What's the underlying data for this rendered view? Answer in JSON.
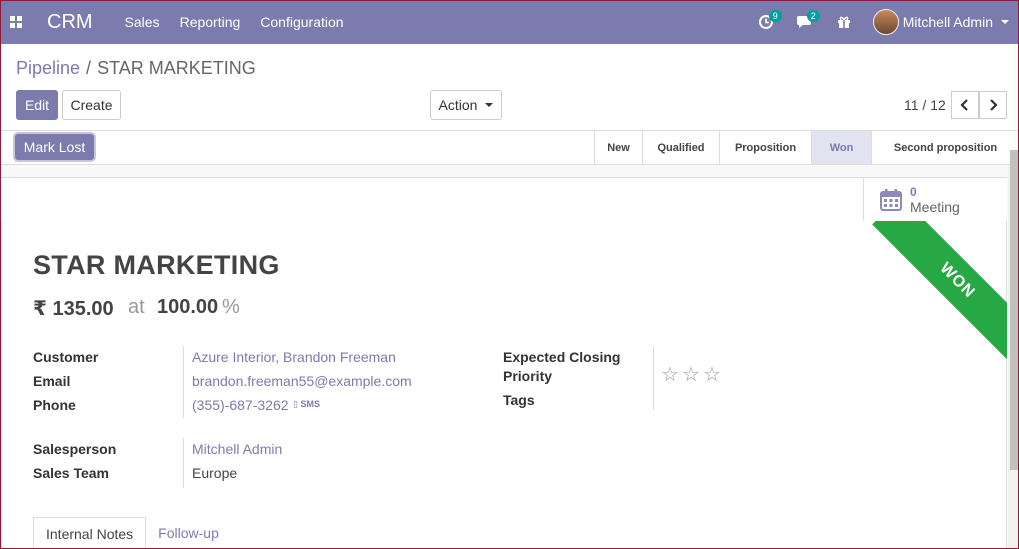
{
  "navbar": {
    "brand": "CRM",
    "menu": [
      "Sales",
      "Reporting",
      "Configuration"
    ],
    "activities_count": "9",
    "messages_count": "2",
    "user_name": "Mitchell Admin"
  },
  "breadcrumb": {
    "parent": "Pipeline",
    "separator": "/",
    "current": "STAR MARKETING"
  },
  "toolbar": {
    "edit_label": "Edit",
    "create_label": "Create",
    "action_label": "Action",
    "pager": "11 / 12"
  },
  "statusbar": {
    "mark_lost_label": "Mark Lost",
    "stages": [
      "New",
      "Qualified",
      "Proposition",
      "Won",
      "Second proposition"
    ],
    "active_stage": "Won"
  },
  "smart_button": {
    "count": "0",
    "label": "Meeting"
  },
  "ribbon": "WON",
  "lead": {
    "name": "STAR MARKETING",
    "revenue": "₹ 135.00",
    "at": "at",
    "probability": "100.00",
    "percent": "%"
  },
  "fields": {
    "customer_label": "Customer",
    "customer_value": "Azure Interior, Brandon Freeman",
    "email_label": "Email",
    "email_value": "brandon.freeman55@example.com",
    "phone_label": "Phone",
    "phone_value": "(355)-687-3262",
    "sms_label": "SMS",
    "salesperson_label": "Salesperson",
    "salesperson_value": "Mitchell Admin",
    "sales_team_label": "Sales Team",
    "sales_team_value": "Europe",
    "expected_closing_label": "Expected Closing",
    "priority_label": "Priority",
    "priority_stars": 0,
    "tags_label": "Tags"
  },
  "tabs": [
    "Internal Notes",
    "Follow-up"
  ],
  "colors": {
    "brand": "#7c7bad",
    "won_ribbon": "#28a745",
    "badge": "#00a09d"
  }
}
